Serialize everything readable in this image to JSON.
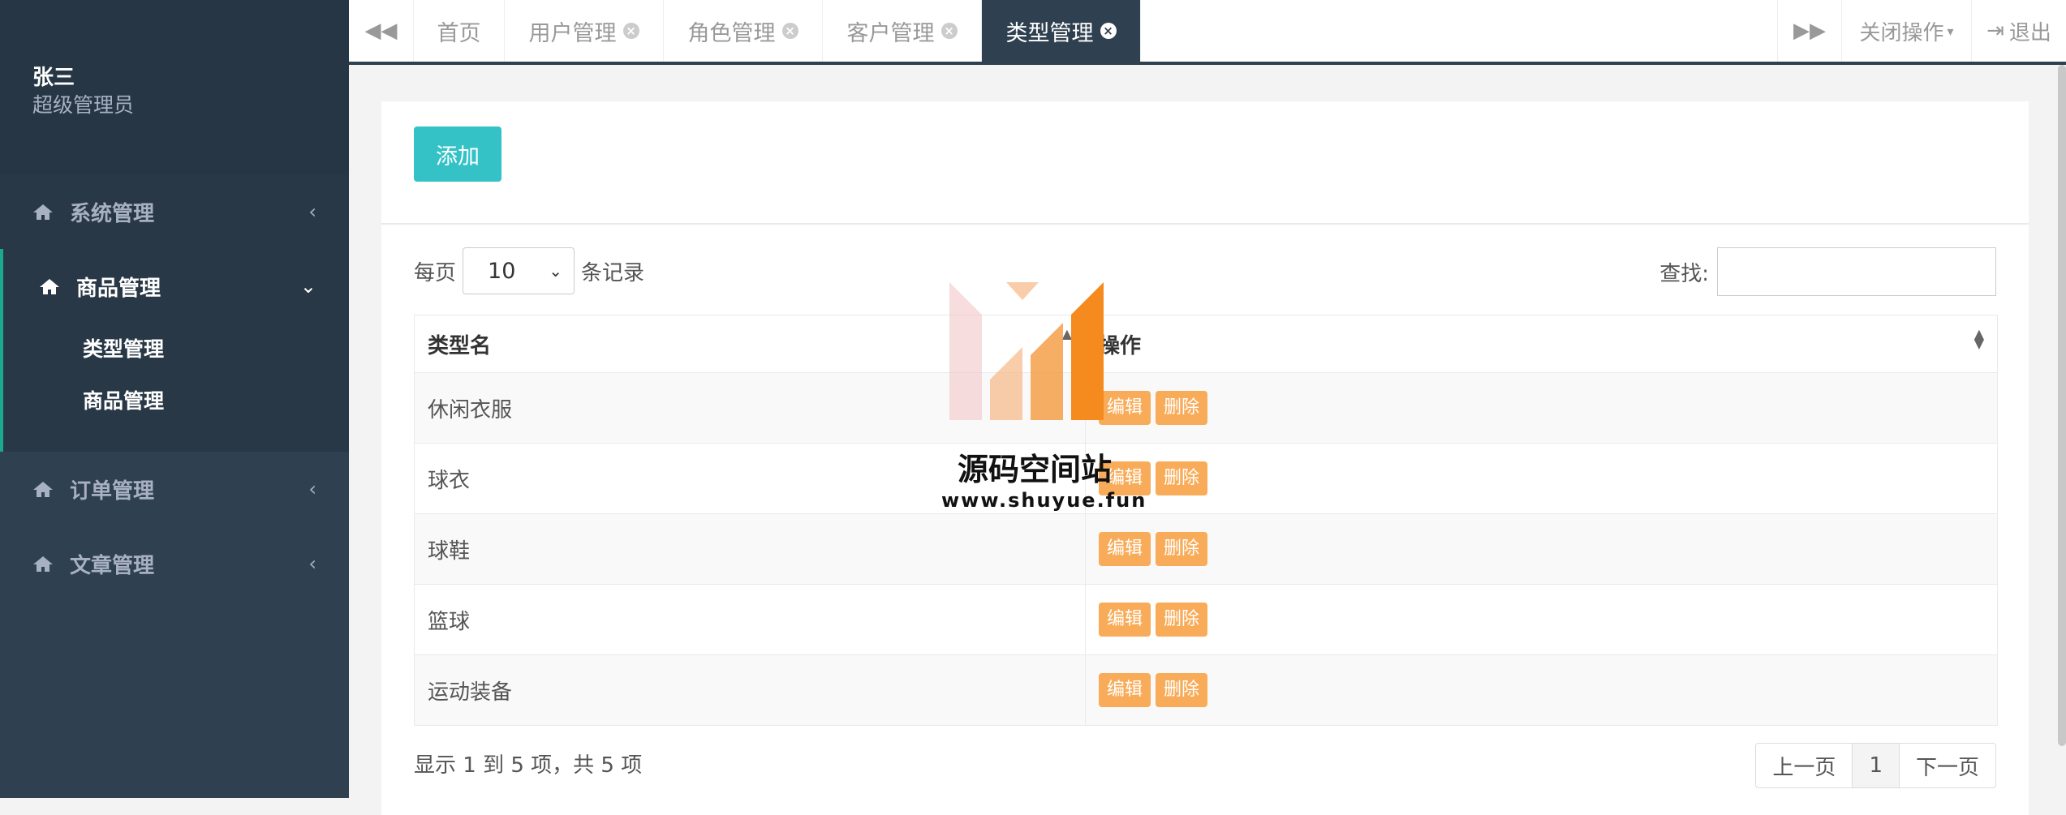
{
  "user": {
    "name": "张三",
    "role": "超级管理员"
  },
  "sidebar": {
    "items": [
      {
        "label": "系统管理"
      },
      {
        "label": "商品管理",
        "children": [
          "类型管理",
          "商品管理"
        ]
      },
      {
        "label": "订单管理"
      },
      {
        "label": "文章管理"
      }
    ]
  },
  "tabs": [
    {
      "label": "首页"
    },
    {
      "label": "用户管理"
    },
    {
      "label": "角色管理"
    },
    {
      "label": "客户管理"
    },
    {
      "label": "类型管理"
    }
  ],
  "topbar": {
    "close_ops": "关闭操作",
    "logout": "退出"
  },
  "toolbar": {
    "add_label": "添加"
  },
  "table_controls": {
    "per_page_prefix": "每页",
    "per_page_value": "10",
    "per_page_suffix": "条记录",
    "search_label": "查找:"
  },
  "table": {
    "headers": [
      "类型名",
      "操作"
    ],
    "rows": [
      {
        "name": "休闲衣服"
      },
      {
        "name": "球衣"
      },
      {
        "name": "球鞋"
      },
      {
        "name": "篮球"
      },
      {
        "name": "运动装备"
      }
    ],
    "edit_label": "编辑",
    "delete_label": "删除"
  },
  "footer": {
    "info": "显示 1 到 5 项，共 5 项",
    "prev": "上一页",
    "page": "1",
    "next": "下一页"
  },
  "watermark": {
    "title": "源码空间站",
    "url": "www.shuyue.fun"
  },
  "colors": {
    "sidebar": "#2f4050",
    "add_button": "#34c2c6",
    "op_button": "#f8ac59"
  }
}
